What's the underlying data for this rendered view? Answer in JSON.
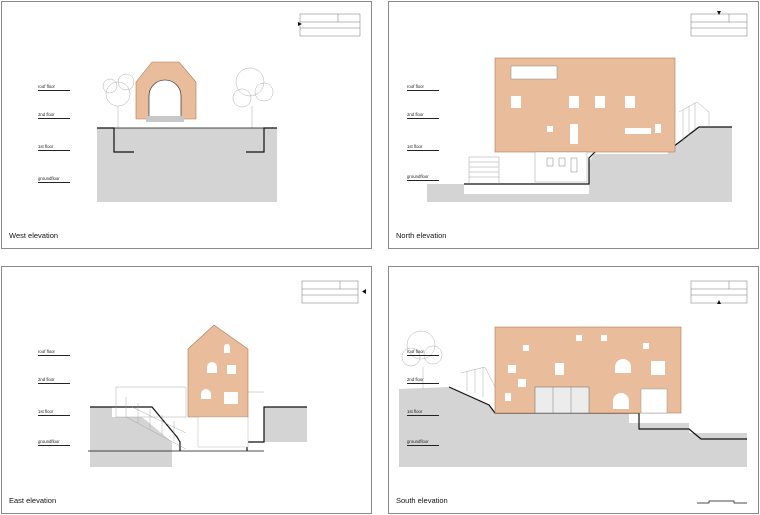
{
  "sheets": {
    "west": {
      "title": "West elevation"
    },
    "north": {
      "title": "North elevation"
    },
    "east": {
      "title": "East elevation"
    },
    "south": {
      "title": "South elevation"
    }
  },
  "levels": {
    "roof": "roof floor",
    "second": "2nd floor",
    "first": "1st floor",
    "ground": "groundfloor"
  },
  "colors": {
    "brick": "#e9bc9c",
    "brick_stroke": "#b07a58",
    "ground": "#d4d4d4",
    "line": "#111111"
  }
}
